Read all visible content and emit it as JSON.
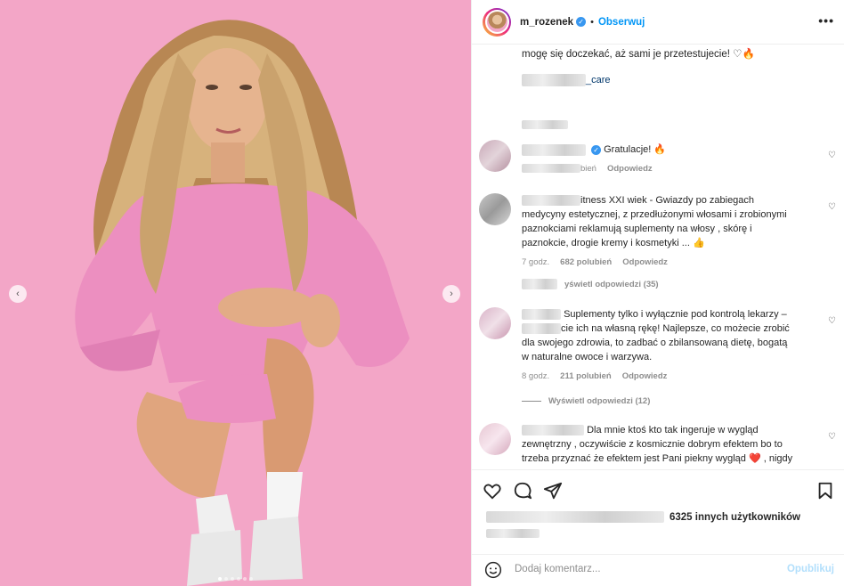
{
  "header": {
    "username": "m_rozenek",
    "separator": "•",
    "follow_label": "Obserwuj",
    "more_label": "•••"
  },
  "caption": {
    "text": "mogę się doczekać, aż sami je przetestujecie! ♡🔥",
    "mention_suffix": "_care"
  },
  "comments": [
    {
      "text": "Gratulacje! 🔥",
      "likes_suffix": "bień",
      "reply_label": "Odpowiedz"
    },
    {
      "text_lines": [
        "itness XXI wiek - Gwiazdy po zabiegach",
        "medycyny estetycznej, z przedłużonymi włosami i zrobionymi",
        "paznokciami reklamują suplementy na włosy , skórę i",
        "paznokcie, drogie kremy i kosmetyki ... 👍"
      ],
      "time": "7 godz.",
      "likes": "682 polubień",
      "reply_label": "Odpowiedz",
      "view_replies": "yświetl odpowiedzi (35)"
    },
    {
      "text_lines": [
        "Suplementy tylko i wyłącznie pod kontrolą lekarzy –",
        "cie ich na własną rękę! Najlepsze, co możecie zrobić",
        "dla swojego zdrowia, to zadbać o zbilansowaną dietę, bogatą",
        "w naturalne owoce i warzywa."
      ],
      "time": "8 godz.",
      "likes": "211 polubień",
      "reply_label": "Odpowiedz",
      "view_replies": "Wyświetl odpowiedzi (12)"
    },
    {
      "text_lines": [
        "Dla mnie ktoś kto tak ingeruje w wygląd",
        "zewnętrzny , oczywiście z kosmicznie dobrym efektem bo to",
        "trzeba przyznać że efektem jest Pani piekny wygląd ❤️ , nigdy"
      ]
    }
  ],
  "likes_summary": "6325 innych użytkowników",
  "add_comment": {
    "placeholder": "Dodaj komentarz...",
    "post_label": "Opublikuj"
  },
  "colors": {
    "background_pink": "#f3a6c7",
    "dress_pink": "#ec8fc0",
    "accent_blue": "#0095f6",
    "post_disabled": "#b2dffc"
  },
  "icons": [
    "verified-icon",
    "more-icon",
    "heart-icon",
    "comment-icon",
    "share-icon",
    "bookmark-icon",
    "emoji-icon",
    "chevron-left-icon",
    "chevron-right-icon"
  ]
}
